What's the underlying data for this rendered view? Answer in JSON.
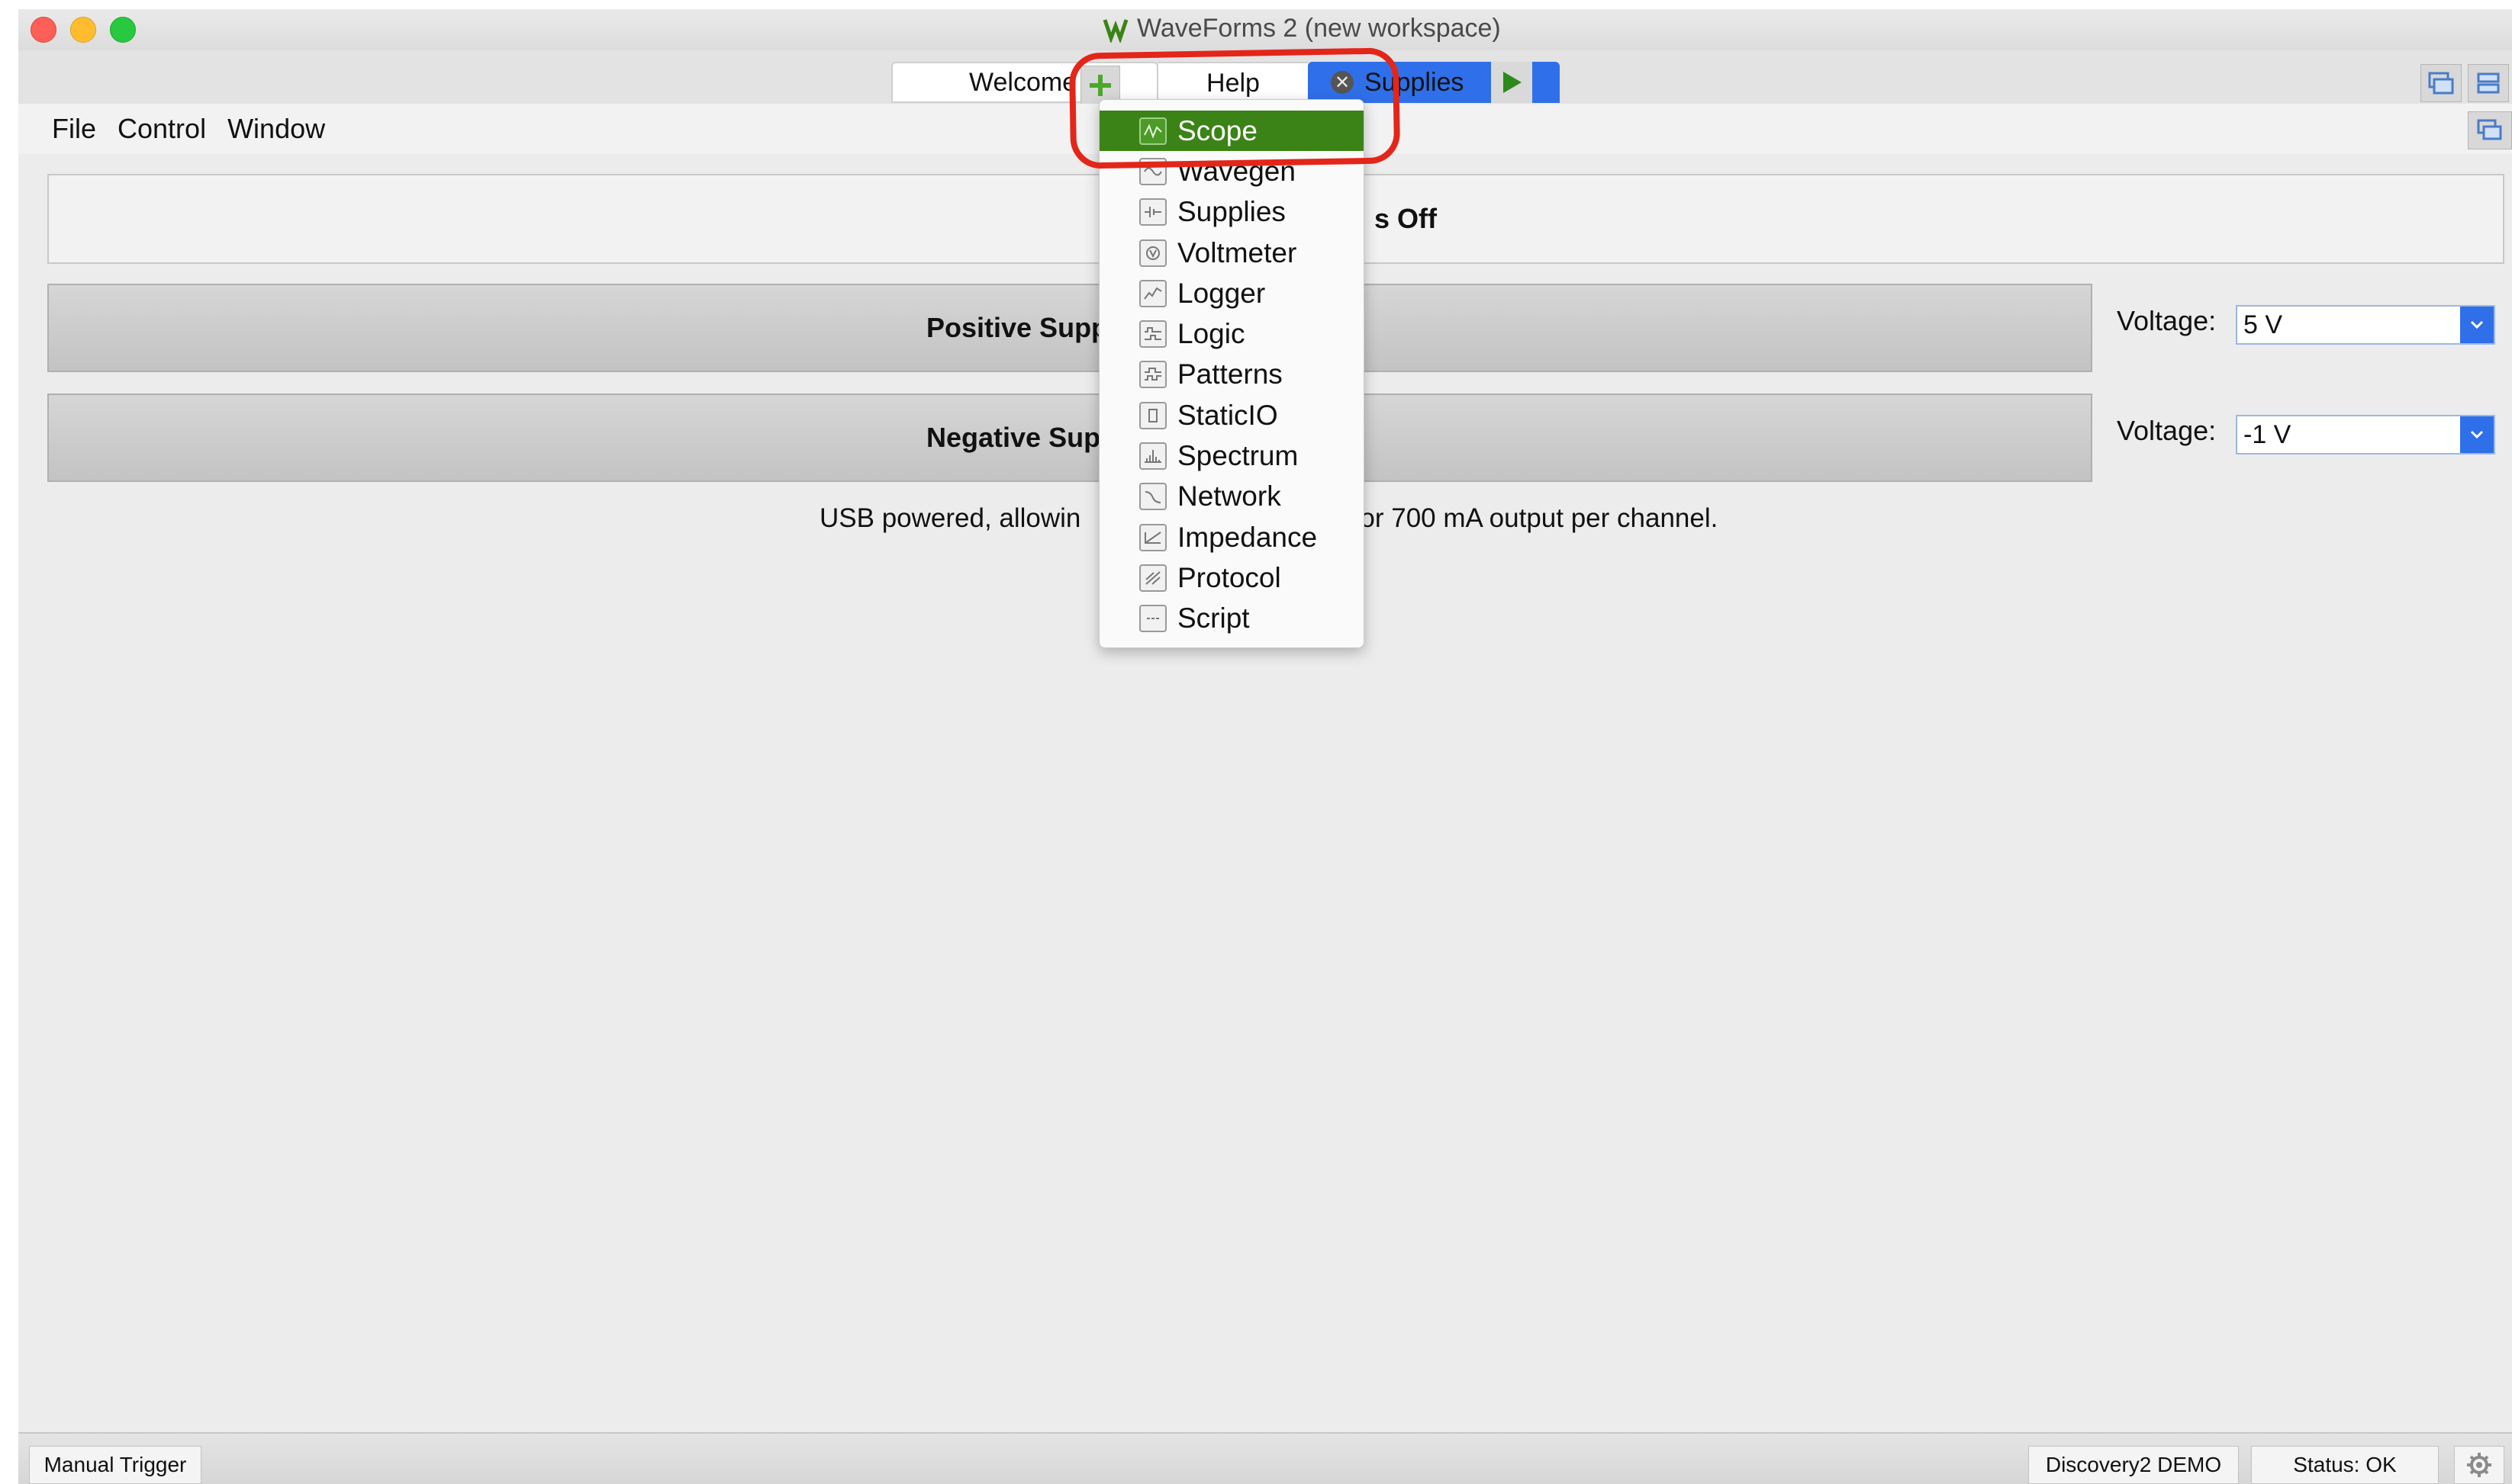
{
  "window": {
    "title": "WaveForms 2 (new workspace)"
  },
  "tabs": {
    "welcome_label": "Welcome",
    "help_label": "Help",
    "supplies_label": "Supplies"
  },
  "menu": {
    "file": "File",
    "control": "Control",
    "window": "Window"
  },
  "content": {
    "master_label": "s Off",
    "positive_label": "Positive Supp",
    "negative_label": "Negative Supp",
    "voltage_label": "Voltage:",
    "positive_voltage": "5 V",
    "negative_voltage": "-1 V",
    "info_left": "USB powered, allowin",
    "info_right": "or 700 mA output per channel."
  },
  "dropdown": {
    "items": [
      {
        "label": "Scope",
        "icon": "scope-icon"
      },
      {
        "label": "Wavegen",
        "icon": "wavegen-icon"
      },
      {
        "label": "Supplies",
        "icon": "supplies-icon"
      },
      {
        "label": "Voltmeter",
        "icon": "voltmeter-icon"
      },
      {
        "label": "Logger",
        "icon": "logger-icon"
      },
      {
        "label": "Logic",
        "icon": "logic-icon"
      },
      {
        "label": "Patterns",
        "icon": "patterns-icon"
      },
      {
        "label": "StaticIO",
        "icon": "staticio-icon"
      },
      {
        "label": "Spectrum",
        "icon": "spectrum-icon"
      },
      {
        "label": "Network",
        "icon": "network-icon"
      },
      {
        "label": "Impedance",
        "icon": "impedance-icon"
      },
      {
        "label": "Protocol",
        "icon": "protocol-icon"
      },
      {
        "label": "Script",
        "icon": "script-icon"
      }
    ],
    "selected": "Scope"
  },
  "statusbar": {
    "trigger": "Manual Trigger",
    "device": "Discovery2 DEMO",
    "status": "Status: OK"
  },
  "colors": {
    "accent_blue": "#2f6fe9",
    "menu_highlight_green": "#3b8316",
    "annotation_red": "#e3261a"
  }
}
